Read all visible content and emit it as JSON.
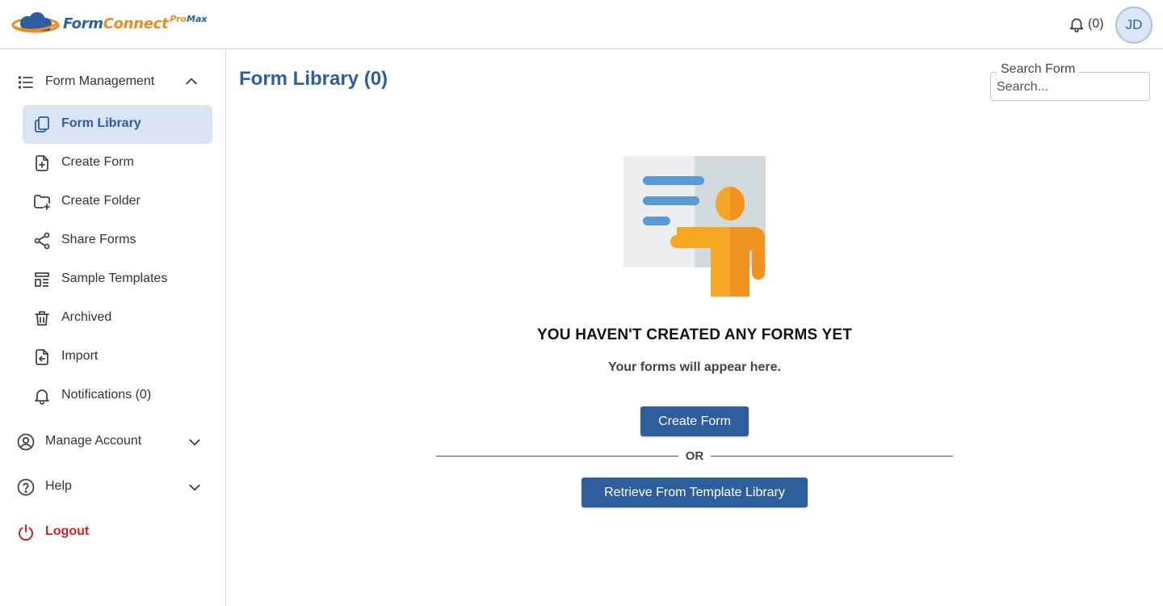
{
  "header": {
    "logo_text_main": "Form",
    "logo_text_accent": "Connect",
    "logo_sup_pro": "Pro",
    "logo_sup_max": "Max",
    "notifications_count": "(0)",
    "user_initials": "JD"
  },
  "sidebar": {
    "form_management": {
      "label": "Form Management",
      "items": [
        {
          "label": "Form Library",
          "icon": "copy-icon",
          "active": true
        },
        {
          "label": "Create Form",
          "icon": "file-plus-icon"
        },
        {
          "label": "Create Folder",
          "icon": "folder-plus-icon"
        },
        {
          "label": "Share Forms",
          "icon": "share-icon"
        },
        {
          "label": "Sample Templates",
          "icon": "template-icon"
        },
        {
          "label": "Archived",
          "icon": "trash-icon"
        },
        {
          "label": "Import",
          "icon": "file-import-icon"
        },
        {
          "label": "Notifications (0)",
          "icon": "bell-icon"
        }
      ]
    },
    "manage_account": {
      "label": "Manage Account"
    },
    "help": {
      "label": "Help"
    },
    "logout": {
      "label": "Logout"
    }
  },
  "main": {
    "title": "Form Library (0)",
    "search": {
      "legend": "Search Form",
      "placeholder": "Search..."
    },
    "empty_state": {
      "title": "YOU HAVEN'T CREATED ANY FORMS YET",
      "subtitle": "Your forms will appear here.",
      "create_button": "Create Form",
      "or_text": "OR",
      "retrieve_button": "Retrieve From Template Library"
    }
  },
  "colors": {
    "primary": "#2c5fa0",
    "button": "#2f5e9c",
    "active_bg": "#dae4f3",
    "logout": "#d42222",
    "accent_orange": "#f08a1d"
  }
}
